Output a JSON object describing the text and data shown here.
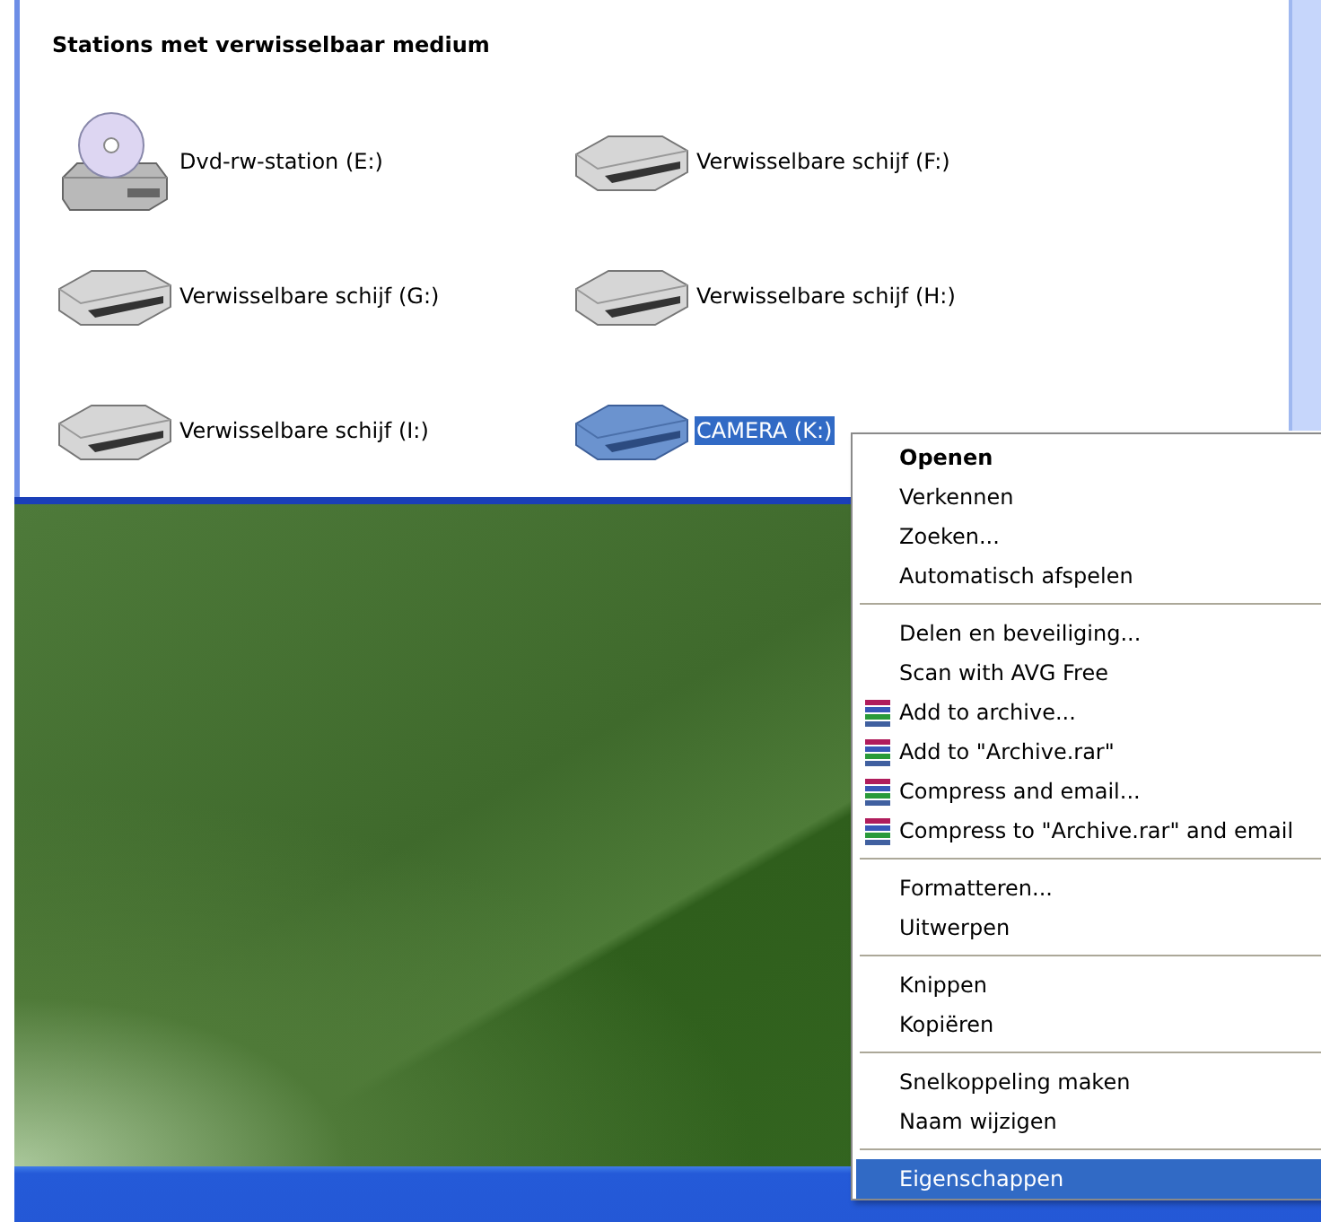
{
  "section": {
    "title": "Stations met verwisselbaar medium"
  },
  "drives": [
    {
      "label": "Dvd-rw-station (E:)",
      "kind": "cd",
      "selected": false
    },
    {
      "label": "Verwisselbare schijf (F:)",
      "kind": "removable",
      "selected": false
    },
    {
      "label": "Verwisselbare schijf (G:)",
      "kind": "removable",
      "selected": false
    },
    {
      "label": "Verwisselbare schijf (H:)",
      "kind": "removable",
      "selected": false
    },
    {
      "label": "Verwisselbare schijf (I:)",
      "kind": "removable",
      "selected": false
    },
    {
      "label": "CAMERA (K:)",
      "kind": "removable",
      "selected": true
    }
  ],
  "context_menu": {
    "groups": [
      [
        {
          "label": "Openen",
          "default": true,
          "kind": "plain",
          "selected": false
        },
        {
          "label": "Verkennen",
          "default": false,
          "kind": "plain",
          "selected": false
        },
        {
          "label": "Zoeken...",
          "default": false,
          "kind": "plain",
          "selected": false
        },
        {
          "label": "Automatisch afspelen",
          "default": false,
          "kind": "plain",
          "selected": false
        }
      ],
      [
        {
          "label": "Delen en beveiliging...",
          "default": false,
          "kind": "plain",
          "selected": false
        },
        {
          "label": "Scan with AVG Free",
          "default": false,
          "kind": "plain",
          "selected": false
        },
        {
          "label": "Add to archive...",
          "default": false,
          "kind": "archive",
          "selected": false
        },
        {
          "label": "Add to \"Archive.rar\"",
          "default": false,
          "kind": "archive",
          "selected": false
        },
        {
          "label": "Compress and email...",
          "default": false,
          "kind": "archive",
          "selected": false
        },
        {
          "label": "Compress to \"Archive.rar\" and email",
          "default": false,
          "kind": "archive",
          "selected": false
        }
      ],
      [
        {
          "label": "Formatteren...",
          "default": false,
          "kind": "plain",
          "selected": false
        },
        {
          "label": "Uitwerpen",
          "default": false,
          "kind": "plain",
          "selected": false
        }
      ],
      [
        {
          "label": "Knippen",
          "default": false,
          "kind": "plain",
          "selected": false
        },
        {
          "label": "Kopiëren",
          "default": false,
          "kind": "plain",
          "selected": false
        }
      ],
      [
        {
          "label": "Snelkoppeling maken",
          "default": false,
          "kind": "plain",
          "selected": false
        },
        {
          "label": "Naam wijzigen",
          "default": false,
          "kind": "plain",
          "selected": false
        }
      ],
      [
        {
          "label": "Eigenschappen",
          "default": false,
          "kind": "plain",
          "selected": true
        }
      ]
    ]
  }
}
